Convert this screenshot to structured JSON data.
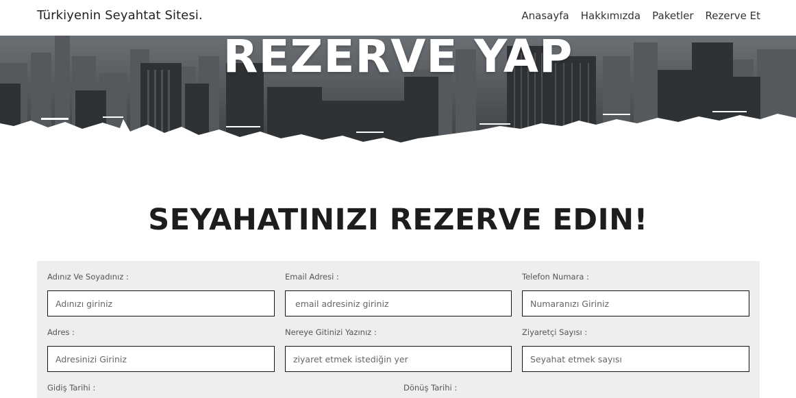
{
  "nav": {
    "brand": "Türkiyenin Seyahtat Sitesi.",
    "links": [
      "Anasayfa",
      "Hakkımızda",
      "Paketler",
      "Rezerve Et"
    ]
  },
  "hero": {
    "title": "REZERVE YAP"
  },
  "section": {
    "title": "SEYAHATINIZI REZERVE EDIN!"
  },
  "form": {
    "name_label": "Adınız Ve Soyadınız :",
    "name_placeholder": "Adınızı giriniz",
    "email_label": "Email Adresi :",
    "email_placeholder": "email adresiniz giriniz",
    "phone_label": "Telefon Numara :",
    "phone_placeholder": "Numaranızı Giriniz",
    "address_label": "Adres :",
    "address_placeholder": "Adresinizi Giriniz",
    "destination_label": "Nereye Gitinizi Yazınız :",
    "destination_placeholder": "ziyaret etmek istediğin yer",
    "visitors_label": "Ziyaretçi Sayısı :",
    "visitors_placeholder": "Seyahat etmek sayısı",
    "departure_label": "Gidiş Tarihi :",
    "return_label": "Dönüş Tarihi :"
  }
}
